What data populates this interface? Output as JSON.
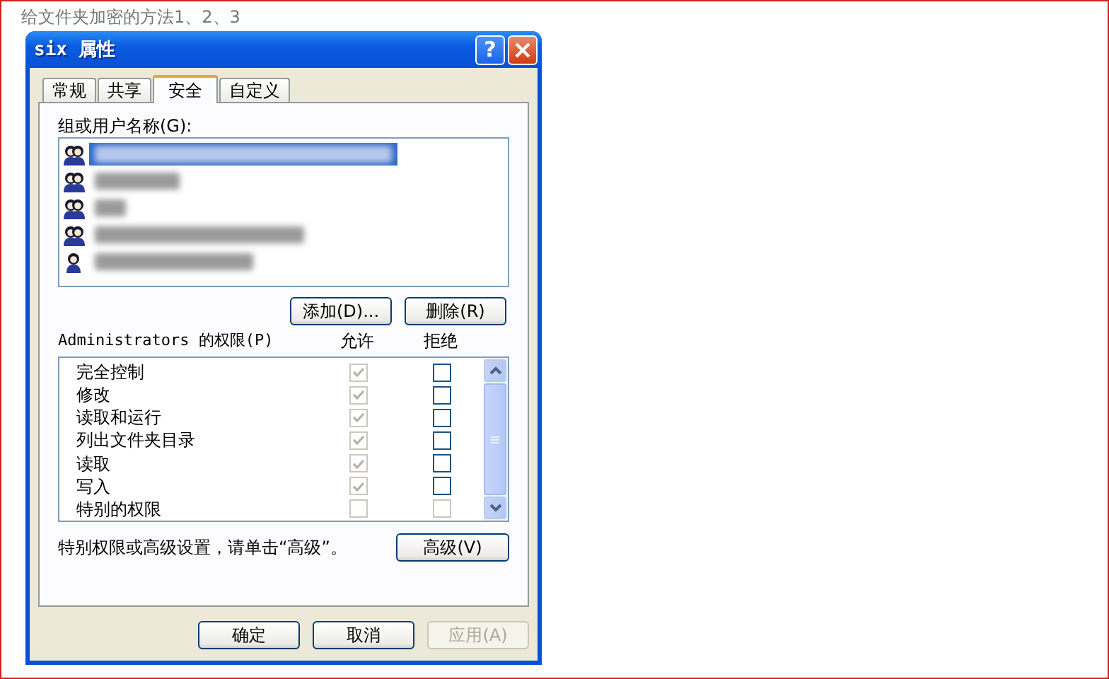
{
  "caption": "给文件夹加密的方法1、2、3",
  "window": {
    "title": "six 属性",
    "help_button": "?"
  },
  "tabs": [
    {
      "label": "常规",
      "selected": false
    },
    {
      "label": "共享",
      "selected": false
    },
    {
      "label": "安全",
      "selected": true
    },
    {
      "label": "自定义",
      "selected": false
    }
  ],
  "groups_label": "组或用户名称(G):",
  "users": [
    {
      "kind": "group",
      "selected": true
    },
    {
      "kind": "group",
      "selected": false
    },
    {
      "kind": "group",
      "selected": false
    },
    {
      "kind": "group",
      "selected": false
    },
    {
      "kind": "user",
      "selected": false
    }
  ],
  "user_buttons": [
    {
      "label": "添加(D)...",
      "disabled": false
    },
    {
      "label": "删除(R)",
      "disabled": false
    }
  ],
  "permissions_label": "Administrators 的权限(P)",
  "permission_columns": [
    "允许",
    "拒绝"
  ],
  "permissions": [
    {
      "name": "完全控制",
      "allow": {
        "checked": true,
        "disabled": true
      },
      "deny": {
        "checked": false,
        "disabled": false
      }
    },
    {
      "name": "修改",
      "allow": {
        "checked": true,
        "disabled": true
      },
      "deny": {
        "checked": false,
        "disabled": false
      }
    },
    {
      "name": "读取和运行",
      "allow": {
        "checked": true,
        "disabled": true
      },
      "deny": {
        "checked": false,
        "disabled": false
      }
    },
    {
      "name": "列出文件夹目录",
      "allow": {
        "checked": true,
        "disabled": true
      },
      "deny": {
        "checked": false,
        "disabled": false
      }
    },
    {
      "name": "读取",
      "allow": {
        "checked": true,
        "disabled": true
      },
      "deny": {
        "checked": false,
        "disabled": false
      }
    },
    {
      "name": "写入",
      "allow": {
        "checked": true,
        "disabled": true
      },
      "deny": {
        "checked": false,
        "disabled": false
      }
    },
    {
      "name": "特别的权限",
      "allow": {
        "checked": false,
        "disabled": true
      },
      "deny": {
        "checked": false,
        "disabled": true
      }
    }
  ],
  "advanced_hint": "特别权限或高级设置，请单击“高级”。",
  "advanced_button": {
    "label": "高级(V)",
    "disabled": false
  },
  "buttons": [
    {
      "label": "确定",
      "disabled": false
    },
    {
      "label": "取消",
      "disabled": false
    },
    {
      "label": "应用(A)",
      "disabled": true
    }
  ]
}
